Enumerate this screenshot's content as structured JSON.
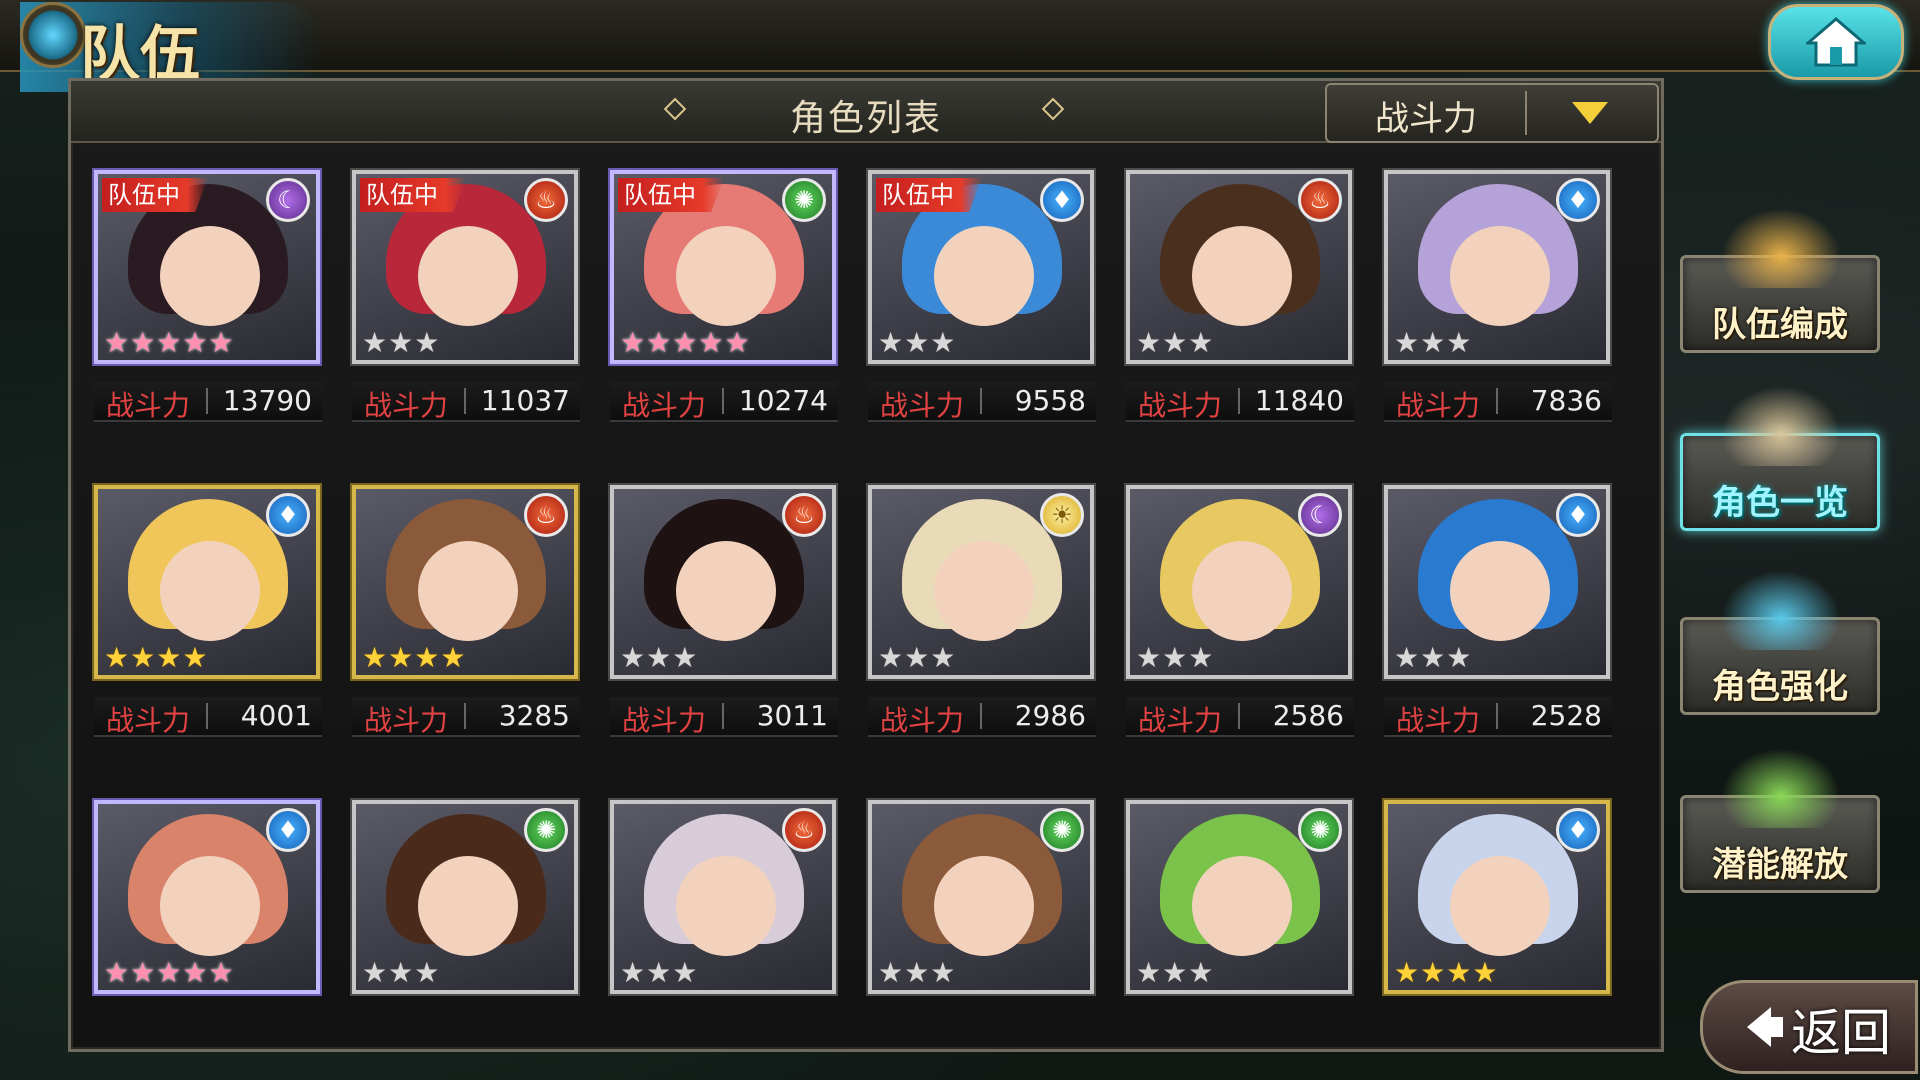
{
  "header": {
    "title": "队伍",
    "home_icon": "home-icon"
  },
  "panel": {
    "title": "角色列表",
    "sort": {
      "selected": "战斗力",
      "dropdown_icon": "triangle-down-icon"
    }
  },
  "power_label": "战斗力",
  "team_badge": "队伍中",
  "characters": [
    {
      "in_team": true,
      "element": "moon",
      "stars": 5,
      "rarity": "rainbow",
      "power": "13790",
      "hair": "#2a1a22"
    },
    {
      "in_team": true,
      "element": "fire",
      "stars": 3,
      "rarity": "silver",
      "power": "11037",
      "hair": "#b8283a"
    },
    {
      "in_team": true,
      "element": "wind",
      "stars": 5,
      "rarity": "rainbow",
      "power": "10274",
      "hair": "#e57b74"
    },
    {
      "in_team": true,
      "element": "water",
      "stars": 3,
      "rarity": "silver",
      "power": "9558",
      "hair": "#3a8ad8"
    },
    {
      "in_team": false,
      "element": "fire",
      "stars": 3,
      "rarity": "silver",
      "power": "11840",
      "hair": "#4a2e1e"
    },
    {
      "in_team": false,
      "element": "water",
      "stars": 3,
      "rarity": "silver",
      "power": "7836",
      "hair": "#b5a2d8"
    },
    {
      "in_team": false,
      "element": "water",
      "stars": 4,
      "rarity": "gold",
      "power": "4001",
      "hair": "#f0c65a"
    },
    {
      "in_team": false,
      "element": "fire",
      "stars": 4,
      "rarity": "gold",
      "power": "3285",
      "hair": "#8a5a3a"
    },
    {
      "in_team": false,
      "element": "fire",
      "stars": 3,
      "rarity": "silver",
      "power": "3011",
      "hair": "#1e1212"
    },
    {
      "in_team": false,
      "element": "light",
      "stars": 3,
      "rarity": "silver",
      "power": "2986",
      "hair": "#eadbb8"
    },
    {
      "in_team": false,
      "element": "moon",
      "stars": 3,
      "rarity": "silver",
      "power": "2586",
      "hair": "#e8c860"
    },
    {
      "in_team": false,
      "element": "water",
      "stars": 3,
      "rarity": "silver",
      "power": "2528",
      "hair": "#2a7ad0"
    },
    {
      "in_team": false,
      "element": "water",
      "stars": 5,
      "rarity": "rainbow",
      "power": "",
      "hair": "#d9846a"
    },
    {
      "in_team": false,
      "element": "wind",
      "stars": 3,
      "rarity": "silver",
      "power": "",
      "hair": "#4a2a1a"
    },
    {
      "in_team": false,
      "element": "fire",
      "stars": 3,
      "rarity": "silver",
      "power": "",
      "hair": "#d8ccd8"
    },
    {
      "in_team": false,
      "element": "wind",
      "stars": 3,
      "rarity": "silver",
      "power": "",
      "hair": "#8a5a3a"
    },
    {
      "in_team": false,
      "element": "wind",
      "stars": 3,
      "rarity": "silver",
      "power": "",
      "hair": "#7ac24a"
    },
    {
      "in_team": false,
      "element": "water",
      "stars": 4,
      "rarity": "gold",
      "power": "",
      "hair": "#c8d4ec"
    }
  ],
  "side_menu": [
    {
      "label": "队伍编成",
      "icon": "team-members-icon",
      "active": false
    },
    {
      "label": "角色一览",
      "icon": "book-icon",
      "active": true
    },
    {
      "label": "角色强化",
      "icon": "enhance-crystal-icon",
      "active": false
    },
    {
      "label": "潜能解放",
      "icon": "potential-orb-icon",
      "active": false
    }
  ],
  "back": {
    "label": "返回",
    "icon": "back-arrow-icon"
  },
  "colors": {
    "power_label": "#e14242",
    "team_badge": "#c41e1e",
    "sort_arrow": "#f4cf3a",
    "active_menu": "#6fe0e6"
  }
}
